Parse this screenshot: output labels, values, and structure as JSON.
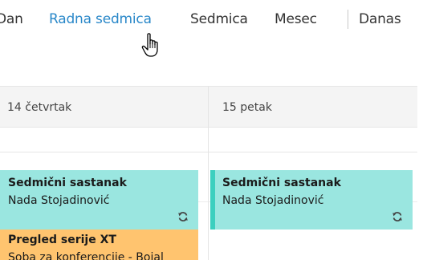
{
  "view_switcher": {
    "tabs": [
      {
        "label": "Dan",
        "active": false
      },
      {
        "label": "Radna sedmica",
        "active": true
      },
      {
        "label": "Sedmica",
        "active": false
      },
      {
        "label": "Mesec",
        "active": false
      }
    ],
    "today_label": "Danas"
  },
  "days": [
    {
      "label": "14 četvrtak"
    },
    {
      "label": "15 petak"
    }
  ],
  "events": [
    {
      "title": "Sedmični sastanak",
      "subtitle": "Nada Stojadinović",
      "color": "#9ae6e0",
      "icon": "recurring-icon"
    },
    {
      "title": "Sedmični sastanak",
      "subtitle": "Nada Stojadinović",
      "color": "#9ae6e0",
      "icon": "recurring-icon"
    },
    {
      "title": "Pregled serije XT",
      "subtitle": "Soba za konferencije - Bojal",
      "color": "#ffc46f"
    }
  ],
  "colors": {
    "accent": "#2a88c9",
    "teal_event": "#9ae6e0",
    "teal_stripe": "#3ccfbf",
    "orange_event": "#ffc46f"
  }
}
